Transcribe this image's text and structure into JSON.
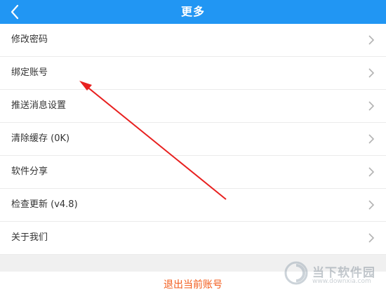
{
  "header": {
    "title": "更多",
    "background": "#2196F3",
    "back_icon": "chevron-left-icon"
  },
  "menu": {
    "items": [
      {
        "label": "修改密码"
      },
      {
        "label": "绑定账号"
      },
      {
        "label": "推送消息设置"
      },
      {
        "label": "清除缓存 (0K)"
      },
      {
        "label": "软件分享"
      },
      {
        "label": "检查更新 (v4.8)"
      },
      {
        "label": "关于我们"
      }
    ],
    "chevron_icon": "chevron-right-icon"
  },
  "logout": {
    "label": "退出当前账号",
    "color": "#F25B1B"
  },
  "annotation": {
    "arrow_color": "#E8201F"
  },
  "watermark": {
    "name": "当下软件园",
    "url": "www.downxia.com"
  }
}
